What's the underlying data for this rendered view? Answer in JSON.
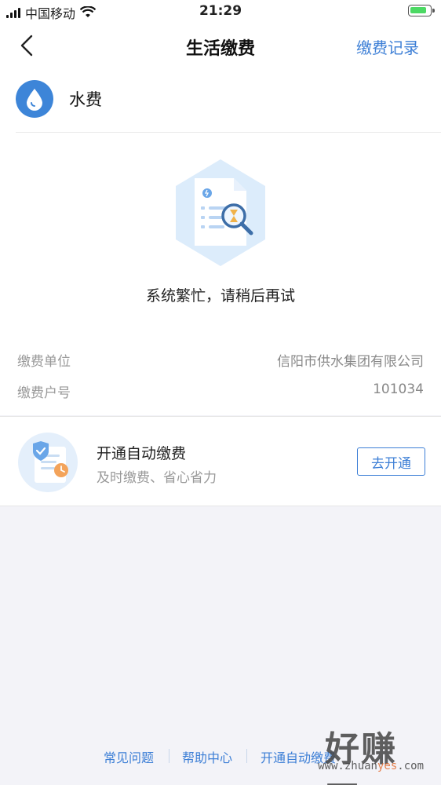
{
  "status_bar": {
    "carrier": "中国移动",
    "time": "21:29"
  },
  "nav": {
    "title": "生活缴费",
    "record_label": "缴费记录"
  },
  "service": {
    "icon": "water-drop-icon",
    "name": "水费"
  },
  "message": "系统繁忙，请稍后再试",
  "info": [
    {
      "label": "缴费单位",
      "value": "信阳市供水集团有限公司"
    },
    {
      "label": "缴费户号",
      "value": "101034"
    }
  ],
  "auto_pay": {
    "title": "开通自动缴费",
    "subtitle": "及时缴费、省心省力",
    "button_label": "去开通"
  },
  "footer": {
    "links": [
      "常见问题",
      "帮助中心",
      "开通自动缴费"
    ]
  },
  "watermark": {
    "main": "好赚网",
    "site_prefix": "www.zhuan",
    "site_highlight": "yes",
    "site_suffix": ".com"
  },
  "colors": {
    "accent": "#3d7fd6",
    "page_bg": "#f3f3f8"
  }
}
